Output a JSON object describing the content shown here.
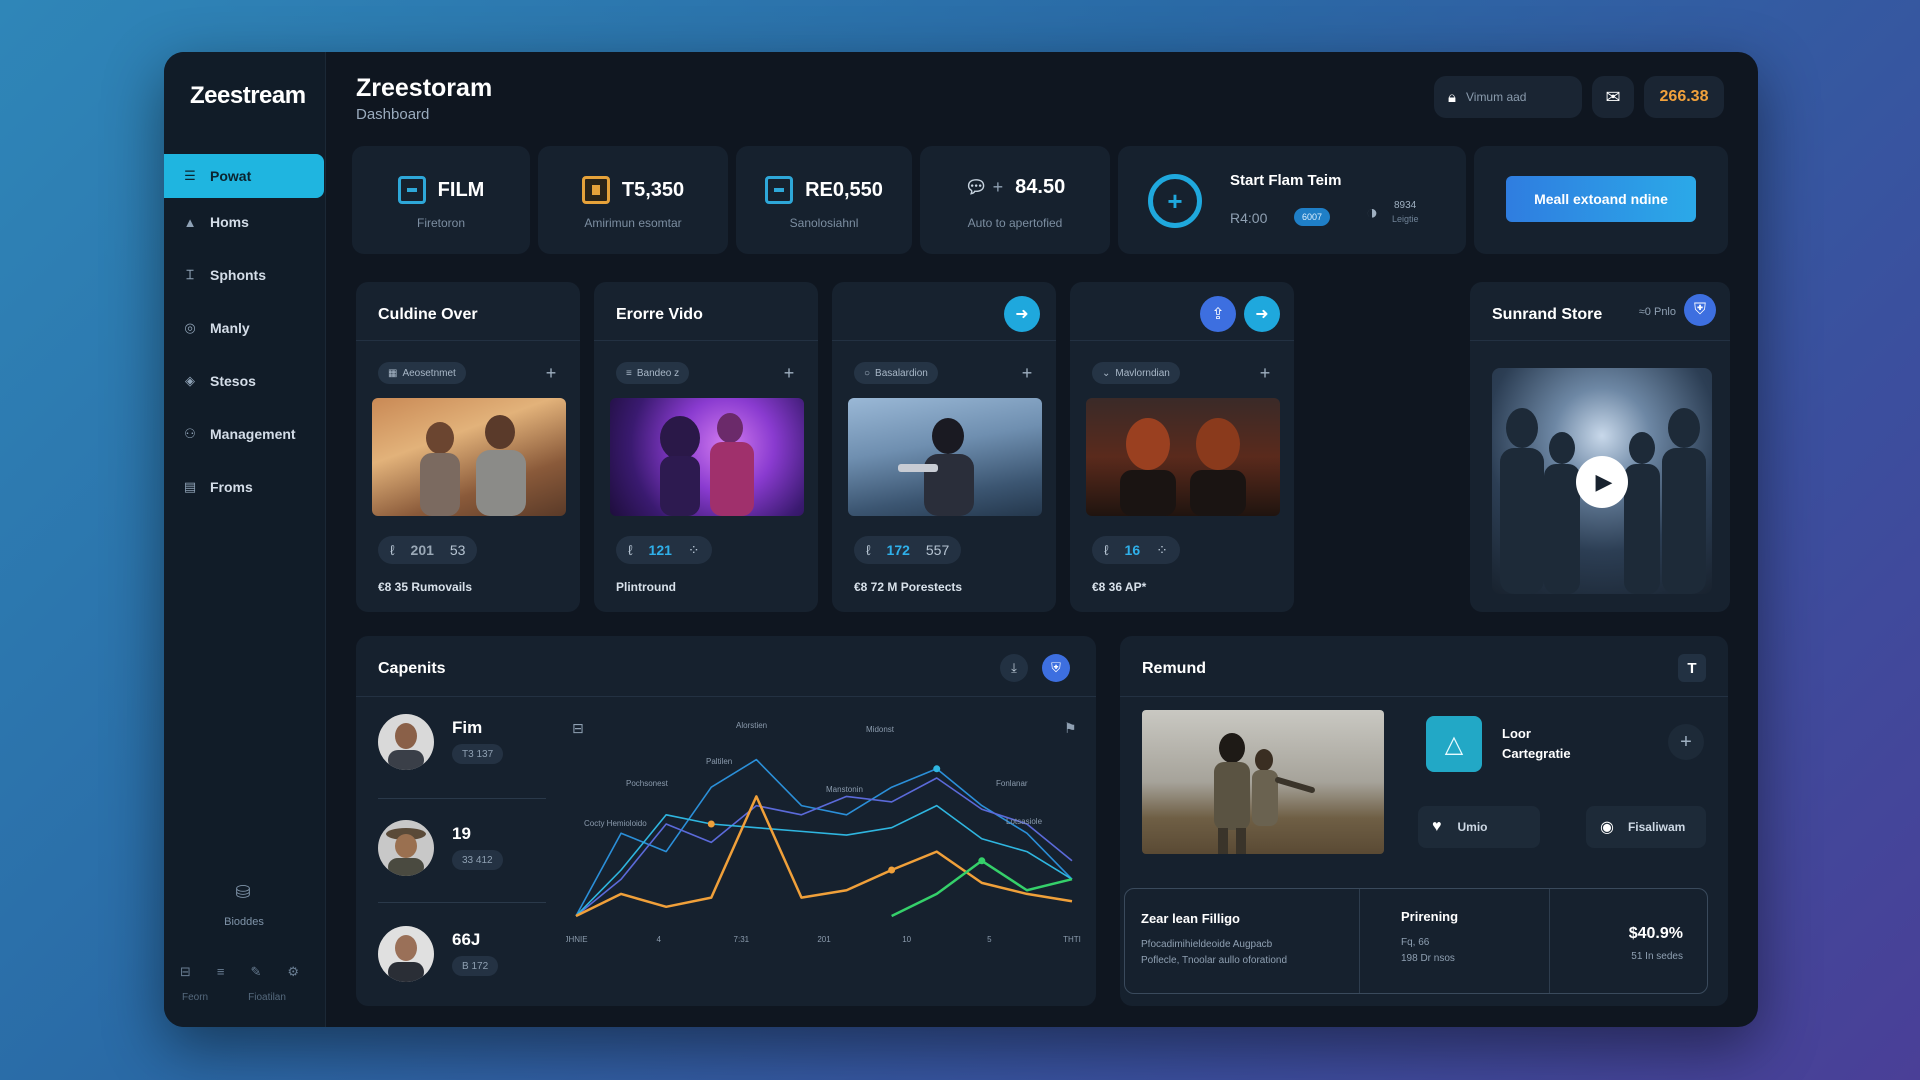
{
  "brand": "Zeestream",
  "header": {
    "title": "Zreestoram",
    "subtitle": "Dashboard",
    "search_placeholder": "Vimum aad",
    "amount": "266.38"
  },
  "sidebar": {
    "items": [
      {
        "label": "Powat",
        "icon": "stack-icon"
      },
      {
        "label": "Homs",
        "icon": "home-icon"
      },
      {
        "label": "Sphonts",
        "icon": "tools-icon"
      },
      {
        "label": "Manly",
        "icon": "globe-icon"
      },
      {
        "label": "Stesos",
        "icon": "layers-icon"
      },
      {
        "label": "Management",
        "icon": "people-icon"
      },
      {
        "label": "Froms",
        "icon": "document-icon"
      }
    ],
    "bottom_label": "Bioddes",
    "footer_labels": [
      "Feorn",
      "Fioatilan"
    ]
  },
  "stats": [
    {
      "value": "FILM",
      "label": "Firetoron",
      "icon": "film-icon"
    },
    {
      "value": "T5,350",
      "label": "Amirimun esomtar",
      "icon": "ticket-icon"
    },
    {
      "value": "RE0,550",
      "label": "Sanolosiahnl",
      "icon": "monitor-icon"
    },
    {
      "value": "84.50",
      "label": "Auto to apertofied",
      "icon": "chat-icon"
    }
  ],
  "stream_card": {
    "title": "Start Flam Teim",
    "time": "R4:00",
    "badge": "6007",
    "side_value": "8934",
    "side_label": "Leigtie"
  },
  "cta": {
    "label": "Meall extoand ndine"
  },
  "media_cards": [
    {
      "title": "Culdine Over",
      "pill": "Aeosetnmet",
      "count_a": "201",
      "count_b": "53",
      "footer": "€8 35 Rumovails"
    },
    {
      "title": "Erorre Vido",
      "pill": "Bandeo z",
      "count_a": "121",
      "count_b": "",
      "footer": "Plintround"
    },
    {
      "title": "",
      "pill": "Basalardion",
      "count_a": "172",
      "count_b": "557",
      "footer": "€8 72 M Porestects"
    },
    {
      "title": "",
      "pill": "Mavlorndian",
      "count_a": "16",
      "count_b": "",
      "footer": "€8 36 AP*"
    }
  ],
  "featured": {
    "title": "Sunrand Store",
    "meta": "≈0 Pnlo"
  },
  "capenits": {
    "title": "Capenits",
    "people": [
      {
        "name": "Fim",
        "badge": "T3 137"
      },
      {
        "name": "19",
        "badge": "33 412"
      },
      {
        "name": "66J",
        "badge": "B 172"
      }
    ]
  },
  "chart_data": {
    "type": "line",
    "x_tick_labels": [
      "JHNIE",
      "4",
      "7:31",
      "201",
      "10",
      "5",
      "THTI"
    ],
    "annotations": [
      "Alorstien",
      "Midonst",
      "Pochsonest",
      "Paltilen",
      "Manstonin",
      "Fonlanar",
      "Cocty Hemioloido",
      "Lotsasiole"
    ],
    "series": [
      {
        "color": "#2b8fd8",
        "values": [
          0,
          45,
          35,
          70,
          85,
          60,
          55,
          70,
          80,
          60,
          45,
          20
        ]
      },
      {
        "color": "#5b6ad9",
        "values": [
          0,
          20,
          50,
          40,
          60,
          55,
          65,
          62,
          75,
          58,
          50,
          30
        ]
      },
      {
        "color": "#2fb6e0",
        "values": [
          0,
          25,
          55,
          50,
          48,
          46,
          44,
          48,
          60,
          42,
          35,
          20
        ]
      },
      {
        "color": "#f0a03a",
        "values": [
          0,
          12,
          5,
          10,
          65,
          10,
          14,
          25,
          35,
          18,
          12,
          8
        ]
      },
      {
        "color": "#35d06a",
        "values": [
          0,
          0,
          0,
          0,
          0,
          0,
          0,
          0,
          12,
          30,
          14,
          20
        ]
      }
    ]
  },
  "remund": {
    "title": "Remund",
    "item_title": "Loor",
    "item_subtitle": "Cartegratie",
    "like_label": "Umio",
    "follow_label": "Fisaliwam",
    "table": {
      "col1_title": "Zear lean Filligo",
      "col1_text_1": "Pfocadimihieldeoide Augpacb",
      "col1_text_2": "Poflecle, Tnoolar aullo oforationd",
      "col2_title": "Prirening",
      "col2_text_1": "Fq, 66",
      "col2_text_2": "198 Dr nsos",
      "col3_value": "$40.9%",
      "col3_text": "51 In sedes"
    }
  },
  "colors": {
    "accent": "#1fb5e0",
    "cta": "#2f7de0",
    "amount": "#f2a23c"
  }
}
